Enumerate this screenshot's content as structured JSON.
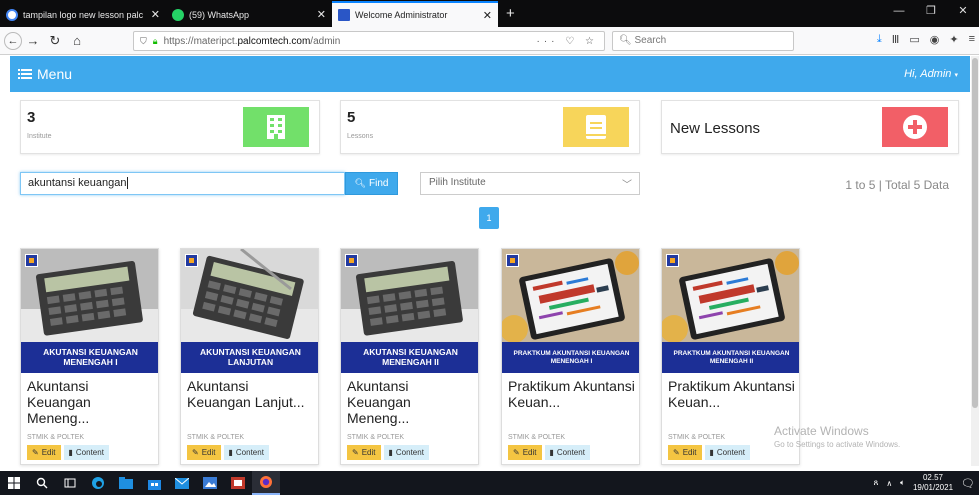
{
  "browser": {
    "tabs": [
      {
        "title": "tampilan logo new lesson palc",
        "favicon_color": "#ffffff",
        "active": false
      },
      {
        "title": "(59) WhatsApp",
        "favicon_color": "#25d366",
        "active": false
      },
      {
        "title": "Welcome Administrator",
        "favicon_color": "#2a56c6",
        "active": true
      }
    ],
    "new_tab": "+",
    "url_prefix": "https://materipct.",
    "url_domain": "palcomtech.com",
    "url_path": "/admin",
    "url_actions": "··· ♡ ☆",
    "search_placeholder": "Search"
  },
  "app": {
    "menu_label": "Menu",
    "greeting": "Hi, Admin",
    "accent_color": "#3fa9ec"
  },
  "stats": {
    "institute": {
      "count": "3",
      "label": "Institute",
      "color": "#72e06a"
    },
    "lessons": {
      "count": "5",
      "label": "Lessons",
      "color": "#f7d55a"
    },
    "new_lessons": {
      "label": "New Lessons",
      "color": "#f25f67"
    }
  },
  "search": {
    "value": "akuntansi keuangan",
    "find_label": "Find",
    "institute_placeholder": "Pilih Institute",
    "summary": "1 to 5 | Total 5 Data",
    "current_page": "1"
  },
  "cards": [
    {
      "banner": "AKUTANSI KEUANGAN MENENGAH I",
      "title": "Akuntansi Keuangan Meneng...",
      "subtitle": "STMIK & POLTEK",
      "art": "calculator"
    },
    {
      "banner": "AKUNTANSI KEUANGAN LANJUTAN",
      "title": "Akuntansi Keuangan Lanjut...",
      "subtitle": "STMIK & POLTEK",
      "art": "calculator-pen"
    },
    {
      "banner": "AKUTANSI KEUANGAN MENENGAH II",
      "title": "Akuntansi Keuangan Meneng...",
      "subtitle": "STMIK & POLTEK",
      "art": "calculator"
    },
    {
      "banner": "PRAKTKUM AKUNTANSI KEUANGAN MENENGAH I",
      "title": "Praktikum Akuntansi Keuan...",
      "subtitle": "STMIK & POLTEK",
      "art": "tablet"
    },
    {
      "banner": "PRAKTKUM AKUNTANSI KEUANGAN MENENGAH II",
      "title": "Praktikum Akuntansi Keuan...",
      "subtitle": "STMIK & POLTEK",
      "art": "tablet"
    }
  ],
  "card_buttons": {
    "edit": "Edit",
    "content": "Content"
  },
  "watermark": {
    "line1": "Activate Windows",
    "line2": "Go to Settings to activate Windows."
  },
  "taskbar": {
    "time": "02.57",
    "date": "19/01/2021"
  }
}
